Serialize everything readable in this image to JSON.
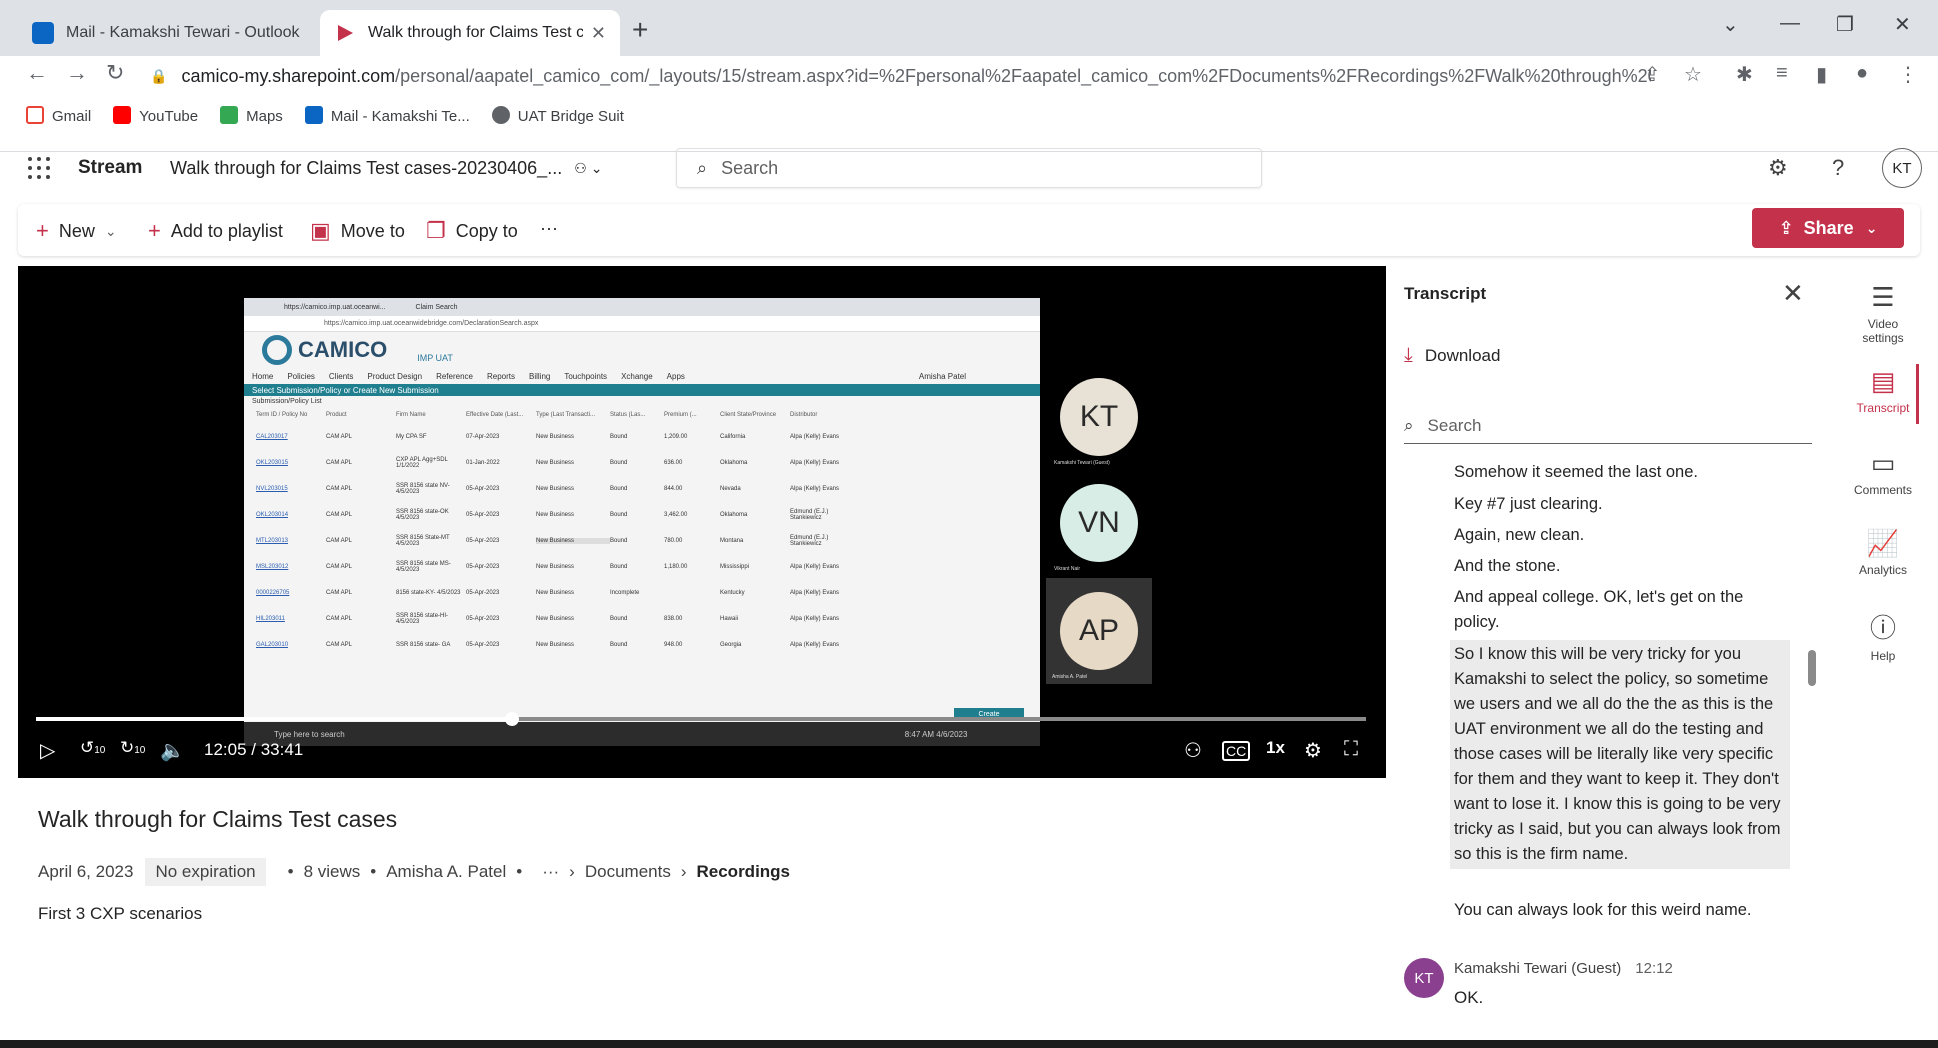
{
  "browser": {
    "tabs": [
      {
        "title": "Mail - Kamakshi Tewari - Outlook",
        "icon": "outlook-icon",
        "active": false
      },
      {
        "title": "Walk through for Claims Test cases",
        "icon": "stream-icon",
        "active": true
      }
    ],
    "url_host": "camico-my.sharepoint.com",
    "url_path": "/personal/aapatel_camico_com/_layouts/15/stream.aspx?id=%2Fpersonal%2Faapatel_camico_com%2FDocuments%2FRecordings%2FWalk%20through%20for...",
    "bookmarks": [
      {
        "label": "Gmail",
        "icon": "gmail-icon",
        "color": "#ea4335"
      },
      {
        "label": "YouTube",
        "icon": "youtube-icon",
        "color": "#ff0000"
      },
      {
        "label": "Maps",
        "icon": "maps-icon",
        "color": "#34a853"
      },
      {
        "label": "Mail - Kamakshi Te...",
        "icon": "outlook-icon",
        "color": "#0a66c2"
      },
      {
        "label": "UAT Bridge Suit",
        "icon": "globe-icon",
        "color": "#5f6368"
      }
    ]
  },
  "stream": {
    "app_name": "Stream",
    "doc_title": "Walk through for Claims Test cases-20230406_...",
    "search_placeholder": "Search",
    "user_initials": "KT",
    "accent": "#c4314b"
  },
  "commands": {
    "new": "New",
    "add_to_playlist": "Add to playlist",
    "move_to": "Move to",
    "copy_to": "Copy to",
    "more": "···",
    "share": "Share"
  },
  "screenshare": {
    "tab1": "https://camico.imp.uat.oceanwi...",
    "tab2": "Claim Search",
    "url": "https://camico.imp.uat.oceanwidebridge.com/DeclarationSearch.aspx",
    "logo": "CAMICO",
    "logo_sub": "IMP UAT",
    "nav": [
      "Home",
      "Policies",
      "Clients",
      "Product Design",
      "Reference",
      "Reports",
      "Billing",
      "Touchpoints",
      "Xchange",
      "Apps"
    ],
    "user": "Amisha Patel",
    "band": "Select Submission/Policy or Create New Submission",
    "sublist": "Submission/Policy List",
    "headers": [
      "Term ID / Policy No",
      "Product",
      "Firm Name",
      "Effective Date (Last...",
      "Type (Last Transacti...",
      "Status (Las...",
      "Premium (...",
      "Taxes (Last...",
      "Client State/Province",
      "Distributor"
    ],
    "rows": [
      [
        "CAL203017",
        "CAM APL",
        "My CPA SF",
        "07-Apr-2023",
        "New Business",
        "Bound",
        "1,209.00",
        "",
        "California",
        "Alpa (Kelly) Evans"
      ],
      [
        "OKL203015",
        "CAM APL",
        "CXP APL Agg+SDL 1/1/2022",
        "01-Jan-2022",
        "New Business",
        "Bound",
        "636.00",
        "",
        "Oklahoma",
        "Alpa (Kelly) Evans"
      ],
      [
        "NVL203015",
        "CAM APL",
        "SSR 8156 state NV- 4/5/2023",
        "05-Apr-2023",
        "New Business",
        "Bound",
        "844.00",
        "",
        "Nevada",
        "Alpa (Kelly) Evans"
      ],
      [
        "OKL203014",
        "CAM APL",
        "SSR 8156 state-OK 4/5/2023",
        "05-Apr-2023",
        "New Business",
        "Bound",
        "3,462.00",
        "",
        "Oklahoma",
        "Edmund (E.J.) Stankiewicz"
      ],
      [
        "MTL203013",
        "CAM APL",
        "SSR 8156 State-MT 4/5/2023",
        "05-Apr-2023",
        "New Business",
        "Bound",
        "780.00",
        "",
        "Montana",
        "Edmund (E.J.) Stankiewicz"
      ],
      [
        "MSL203012",
        "CAM APL",
        "SSR 8156 state MS- 4/5/2023",
        "05-Apr-2023",
        "New Business",
        "Bound",
        "1,180.00",
        "",
        "Mississippi",
        "Alpa (Kelly) Evans"
      ],
      [
        "0000226705",
        "CAM APL",
        "8156 state-KY- 4/5/2023",
        "05-Apr-2023",
        "New Business",
        "Incomplete",
        "",
        "",
        "Kentucky",
        "Alpa (Kelly) Evans"
      ],
      [
        "HIL203011",
        "CAM APL",
        "SSR 8156 state-HI- 4/5/2023",
        "05-Apr-2023",
        "New Business",
        "Bound",
        "838.00",
        "",
        "Hawaii",
        "Alpa (Kelly) Evans"
      ],
      [
        "GAL203010",
        "CAM APL",
        "SSR 8156 state- GA",
        "05-Apr-2023",
        "New Business",
        "Bound",
        "948.00",
        "",
        "Georgia",
        "Alpa (Kelly) Evans"
      ]
    ],
    "taskbar_search": "Type here to search",
    "clock": "8:47 AM 4/6/2023",
    "create": "Create"
  },
  "participants": [
    {
      "initials": "KT",
      "name": "Kamakshi Tewari (Guest)",
      "color": "#e8e1d5"
    },
    {
      "initials": "VN",
      "name": "Vikrant Nair",
      "color": "#d8ede6"
    },
    {
      "initials": "AP",
      "name": "Amisha A. Patel",
      "color": "#e6d9c6"
    }
  ],
  "player": {
    "current_time": "12:05",
    "duration": "33:41",
    "time_display": "12:05 / 33:41",
    "progress": 0.358,
    "rewind": "10",
    "forward": "10",
    "speed": "1x"
  },
  "video": {
    "title": "Walk through for Claims Test cases",
    "date": "April 6, 2023",
    "expiration": "No expiration",
    "views": "8 views",
    "owner": "Amisha A. Patel",
    "more": "···",
    "crumb1": "Documents",
    "crumb2": "Recordings",
    "description": "First 3 CXP scenarios"
  },
  "transcript": {
    "title": "Transcript",
    "download": "Download",
    "search_placeholder": "Search",
    "lines": [
      "Somehow it seemed the last one.",
      "Key #7 just clearing.",
      "Again, new clean.",
      "And the stone.",
      "And appeal college. OK, let's get on the policy.",
      "So I know this will be very tricky for you Kamakshi to select the policy, so sometime we users and we all do the the as this is the UAT environment we all do the testing and those cases will be literally like very specific for them and they want to keep it. They don't want to lose it. I know this is going to be very tricky as I said, but you can always look from so this is the firm name.",
      "You can always look for this weird name."
    ],
    "speaker_initials": "KT",
    "speaker": "Kamakshi Tewari (Guest)",
    "speaker_time": "12:12",
    "speaker_line": "OK."
  },
  "rail": {
    "video_settings": "Video settings",
    "transcript": "Transcript",
    "comments": "Comments",
    "analytics": "Analytics",
    "help": "Help"
  }
}
